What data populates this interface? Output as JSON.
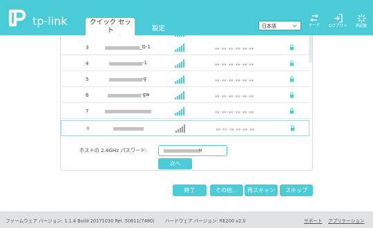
{
  "app": {
    "logo_text": "tp-link"
  },
  "tabs": {
    "quick_setup": "クイック セット\nアップ",
    "settings": "設定"
  },
  "language": {
    "selected": "日本語"
  },
  "header_buttons": {
    "mode": "モード",
    "logout": "ログアウト",
    "reboot": "再起動"
  },
  "networks": [
    {
      "num": "3",
      "ssid_suffix": "_G-1",
      "mac": "▪▪-▪▪-▪▪-▪▪-▪▪-▪▪",
      "signal": 4
    },
    {
      "num": "4",
      "ssid_suffix": "-1",
      "mac": "▪▪-▪▪-▪▪-▪▪-▪▪-▪▪",
      "signal": 4
    },
    {
      "num": "5",
      "ssid_suffix": "-g",
      "mac": "▪▪-▪▪-▪▪-▪▪-▪▪-▪▪",
      "signal": 4
    },
    {
      "num": "6",
      "ssid_suffix": "-gw",
      "mac": "▪▪-▪▪-▪▪-▪▪-▪▪-▪▪",
      "signal": 4
    },
    {
      "num": "7",
      "ssid_suffix": "",
      "mac": "▪▪-▪▪-▪▪-▪▪-▪▪-▪▪",
      "signal": 4
    },
    {
      "num": "8",
      "ssid_suffix": "",
      "mac": "▪▪-▪▪-▪▪-▪▪-▪▪-▪▪",
      "signal": 4
    }
  ],
  "password": {
    "label": "ホストの 2.4GHz パスワード:",
    "visible_char": "u"
  },
  "buttons": {
    "next": "次へ",
    "finish": "終了",
    "other": "その他...",
    "rescan": "再スキャン",
    "skip": "スキップ"
  },
  "footer": {
    "firmware": "ファームウェア バージョン: 1.1.4 Build 20171030 Rel. 50611(7480)",
    "hardware": "ハードウェア バージョン: RE200 v2.0",
    "support": "サポート",
    "app": "アプリケーション"
  },
  "colors": {
    "accent": "#4acbd6",
    "footer_bg": "#dfe3e4"
  }
}
